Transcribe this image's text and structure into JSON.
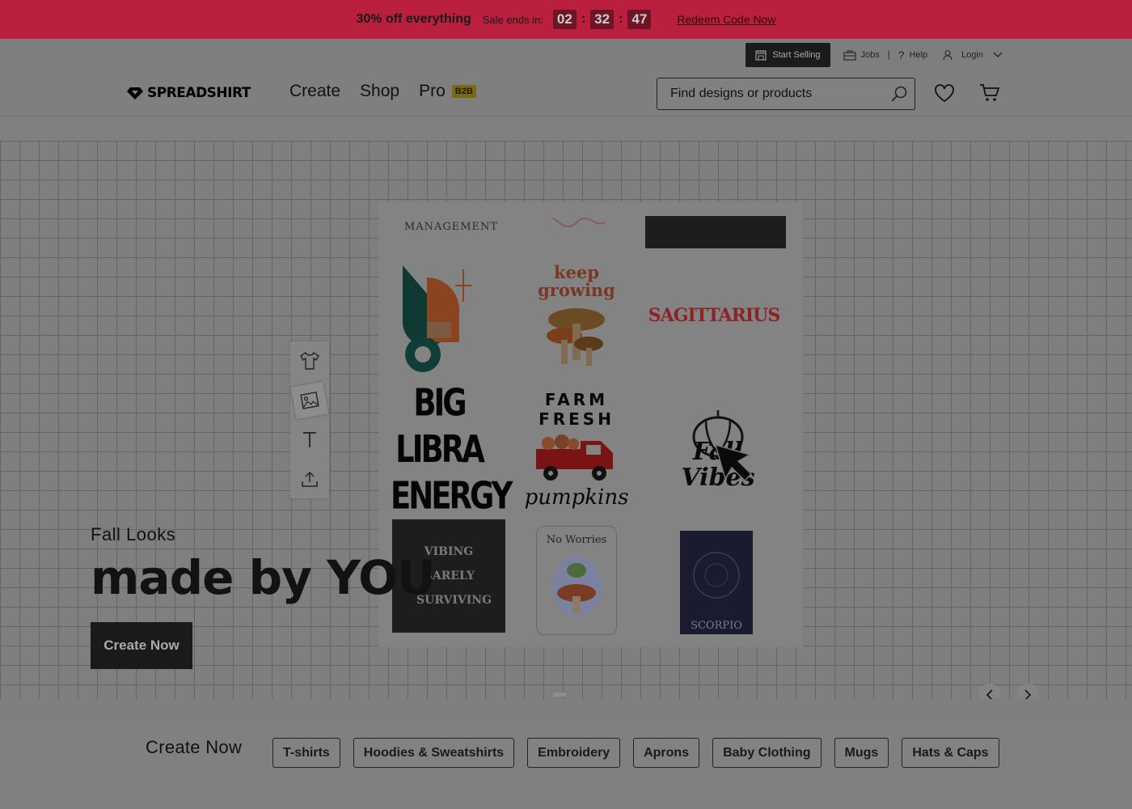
{
  "promo": {
    "headline": "30% off everything",
    "ends_label": "Sale ends in:",
    "timer": {
      "hours": "02",
      "minutes": "32",
      "seconds": "47"
    },
    "redeem_label": "Redeem Code Now"
  },
  "utility": {
    "start_selling": "Start Selling",
    "jobs": "Jobs",
    "help": "Help",
    "login": "Login"
  },
  "header": {
    "logo": "SPREADSHIRT",
    "nav": [
      "Create",
      "Shop",
      "Pro"
    ],
    "pro_badge": "B2B",
    "search_placeholder": "Find designs or products"
  },
  "hero": {
    "kicker": "Fall Looks",
    "title": "made by YOU",
    "cta": "Create Now",
    "designs": {
      "keep_growing": "keep growing",
      "sagittarius": "SAGITTARIUS",
      "big_libra": "BIG LIBRA ENERGY",
      "farm_fresh": "FARM FRESH",
      "pumpkins": "pumpkins",
      "fall_vibes": "Fall Vibes",
      "vibing": "VIBING BARELY SURVIVING",
      "no_worries": "No Worries",
      "scorpio": "SCORPIO",
      "management": "MANAGEMENT"
    }
  },
  "categories": {
    "title": "Create Now",
    "items": [
      "T-shirts",
      "Hoodies & Sweatshirts",
      "Embroidery",
      "Aprons",
      "Baby Clothing",
      "Mugs",
      "Hats & Caps"
    ]
  }
}
